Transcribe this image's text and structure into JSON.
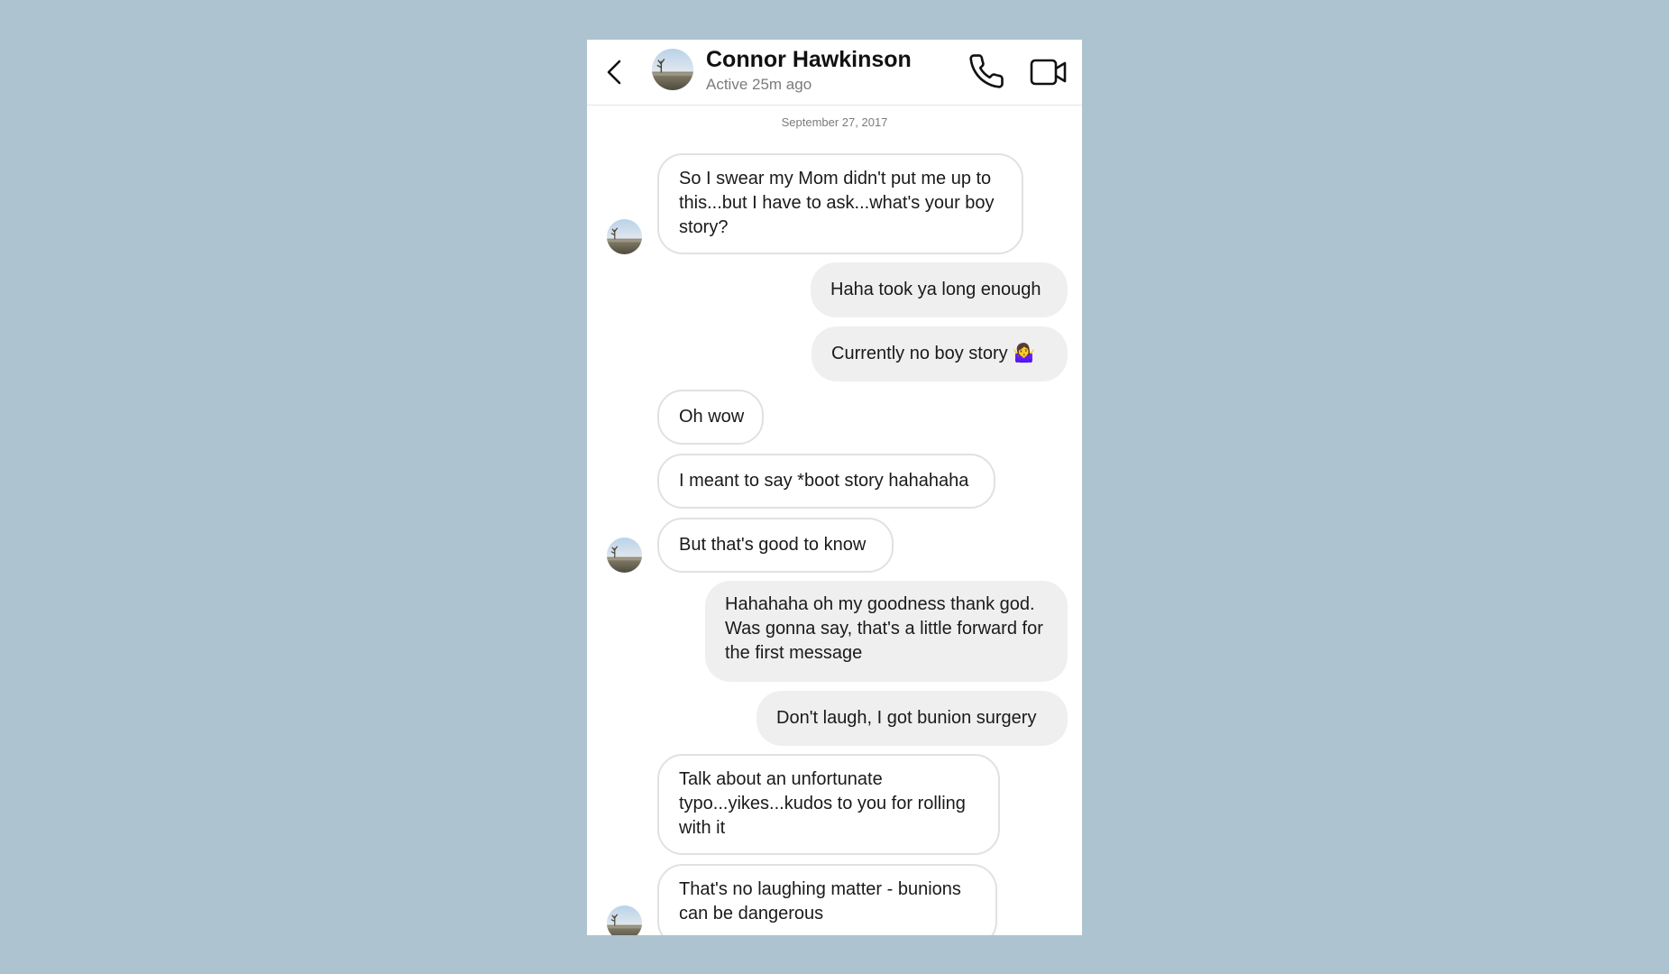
{
  "header": {
    "contact_name": "Connor Hawkinson",
    "status": "Active 25m ago"
  },
  "conversation": {
    "date": "September 27, 2017",
    "messages": [
      {
        "from": "them",
        "text": "So I swear my Mom didn't put me up to this...but I have to ask...what's your boy story?"
      },
      {
        "from": "me",
        "text": "Haha took ya long enough"
      },
      {
        "from": "me",
        "text": "Currently no boy story 🤷‍♀️"
      },
      {
        "from": "them",
        "text": "Oh wow"
      },
      {
        "from": "them",
        "text": "I meant to say *boot story hahahaha"
      },
      {
        "from": "them",
        "text": "But that's good to know"
      },
      {
        "from": "me",
        "text": "Hahahaha oh my goodness thank god. Was gonna say, that's a little forward for the first message"
      },
      {
        "from": "me",
        "text": "Don't laugh, I got bunion surgery"
      },
      {
        "from": "them",
        "text": "Talk about an unfortunate typo...yikes...kudos to you for rolling with it"
      },
      {
        "from": "them",
        "text": "That's no laughing matter - bunions can be dangerous"
      }
    ]
  },
  "icons": {
    "back": "chevron-left-icon",
    "call": "phone-icon",
    "video": "video-camera-icon"
  }
}
